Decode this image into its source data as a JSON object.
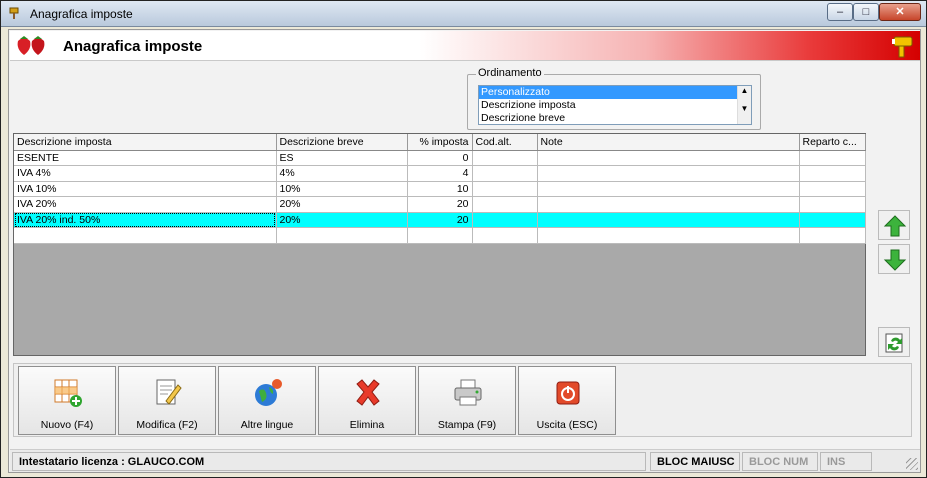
{
  "window": {
    "title": "Anagrafica imposte",
    "controls": {
      "minimize": "–",
      "maximize": "□",
      "close": "✕"
    }
  },
  "header": {
    "title": "Anagrafica imposte"
  },
  "sort": {
    "label": "Ordinamento",
    "options": [
      "Personalizzato",
      "Descrizione imposta",
      "Descrizione breve"
    ],
    "selected_index": 0
  },
  "grid": {
    "columns": [
      "Descrizione imposta",
      "Descrizione breve",
      "% imposta",
      "Cod.alt.",
      "Note",
      "Reparto c..."
    ],
    "rows": [
      [
        "ESENTE",
        "ES",
        "0",
        "",
        "",
        ""
      ],
      [
        "IVA 4%",
        "4%",
        "4",
        "",
        "",
        ""
      ],
      [
        "IVA 10%",
        "10%",
        "10",
        "",
        "",
        ""
      ],
      [
        "IVA 20%",
        "20%",
        "20",
        "",
        "",
        ""
      ],
      [
        "IVA 20% ind. 50%",
        "20%",
        "20",
        "",
        "",
        ""
      ]
    ],
    "selected_row": 4
  },
  "toolbar": {
    "new": "Nuovo (F4)",
    "edit": "Modifica (F2)",
    "languages": "Altre lingue",
    "delete": "Elimina",
    "print": "Stampa (F9)",
    "exit": "Uscita (ESC)"
  },
  "status": {
    "license": "Intestatario licenza : GLAUCO.COM",
    "caps": "BLOC MAIUSC",
    "num": "BLOC NUM",
    "ins": "INS"
  },
  "colors": {
    "selection": "#00ffff",
    "banner_red": "#d40000",
    "list_select": "#3399ff"
  }
}
